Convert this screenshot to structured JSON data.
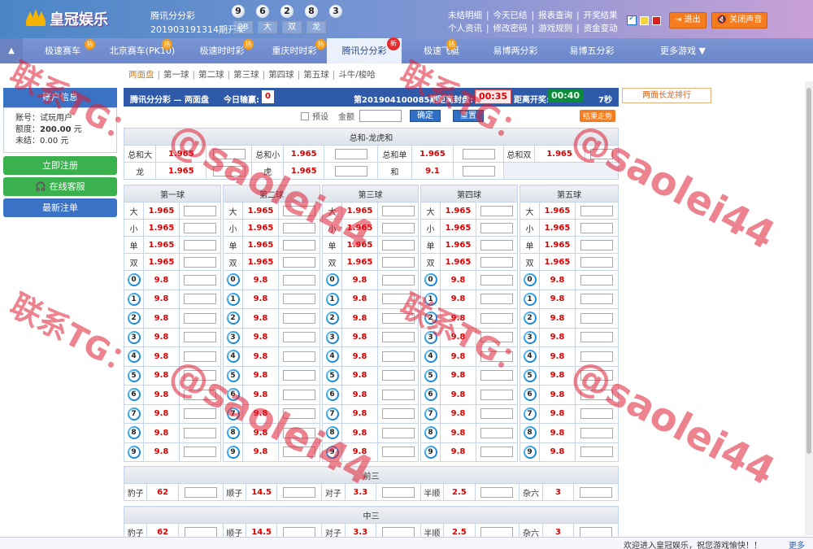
{
  "header": {
    "logo_text": "皇冠娱乐",
    "game_name": "腾讯分分彩",
    "balls": [
      "9",
      "6",
      "2",
      "8",
      "3"
    ],
    "period_text": "201903191314期开奖",
    "results": [
      "28",
      "大",
      "双",
      "龙"
    ],
    "links_row1": [
      "未结明细",
      "今天已结",
      "报表查询",
      "开奖结果"
    ],
    "links_row2": [
      "个人资讯",
      "修改密码",
      "游戏规则",
      "资金变动"
    ],
    "swatch_colors": [
      "#f5d33b",
      "#e21f1f"
    ],
    "logout": "退出",
    "mute": "关闭声音",
    "accent": "#f57c1f"
  },
  "nav": {
    "tabs": [
      {
        "label": "极速赛车",
        "badge": "热"
      },
      {
        "label": "北京赛车(PK10)",
        "badge": "热"
      },
      {
        "label": "极速时时彩",
        "badge": "热"
      },
      {
        "label": "重庆时时彩",
        "badge": "热"
      },
      {
        "label": "腾讯分分彩",
        "badge": "新"
      },
      {
        "label": "极速飞艇",
        "badge": "热"
      },
      {
        "label": "易博两分彩",
        "badge": ""
      },
      {
        "label": "易博五分彩",
        "badge": ""
      },
      {
        "label": "更多游戏 ▼",
        "badge": ""
      }
    ]
  },
  "subnav": [
    "两面盘",
    "第一球",
    "第二球",
    "第三球",
    "第四球",
    "第五球",
    "斗牛/梭哈"
  ],
  "sidebar": {
    "title": "账户信息",
    "account_label": "账号：",
    "account": "试玩用户",
    "limit_label": "额度：",
    "limit": "200.00",
    "unit": "元",
    "unsettled_label": "未结：",
    "unsettled": "0.00",
    "unsettled_unit": "元",
    "btn_bet": "立即注册",
    "btn_service": "在线客服",
    "btn_latest": "最新注单"
  },
  "infobar": {
    "game": "腾讯分分彩 — 两面盘",
    "today_label": "今日输赢:",
    "today_value": "0",
    "period": "第201904100085期",
    "close_label": "距离封盘:",
    "close_time": "00:35",
    "open_label": "距离开奖:",
    "open_time": "00:40",
    "secs": "7秒",
    "long_rank": "两面长龙排行"
  },
  "controls": {
    "preset": "预设",
    "amount": "金额",
    "confirm": "确定",
    "reset": "重置",
    "trend": "结果走势"
  },
  "sum_section": {
    "title": "总和-龙虎和",
    "row1": [
      {
        "label": "总和大",
        "odd": "1.965"
      },
      {
        "label": "总和小",
        "odd": "1.965"
      },
      {
        "label": "总和单",
        "odd": "1.965"
      },
      {
        "label": "总和双",
        "odd": "1.965"
      }
    ],
    "row2": [
      {
        "label": "龙",
        "odd": "1.965"
      },
      {
        "label": "虎",
        "odd": "1.965"
      },
      {
        "label": "和",
        "odd": "9.1"
      }
    ]
  },
  "balls_section": {
    "titles": [
      "第一球",
      "第二球",
      "第三球",
      "第四球",
      "第五球"
    ],
    "bs": [
      {
        "label": "大",
        "odd": "1.965"
      },
      {
        "label": "小",
        "odd": "1.965"
      },
      {
        "label": "单",
        "odd": "1.965"
      },
      {
        "label": "双",
        "odd": "1.965"
      }
    ],
    "numbers": [
      "0",
      "1",
      "2",
      "3",
      "4",
      "5",
      "6",
      "7",
      "8",
      "9"
    ],
    "num_odd": "9.8"
  },
  "front3": {
    "title": "前三",
    "items": [
      {
        "label": "豹子",
        "odd": "62"
      },
      {
        "label": "顺子",
        "odd": "14.5"
      },
      {
        "label": "对子",
        "odd": "3.3"
      },
      {
        "label": "半顺",
        "odd": "2.5"
      },
      {
        "label": "杂六",
        "odd": "3"
      }
    ]
  },
  "mid3": {
    "title": "中三",
    "items": [
      {
        "label": "豹子",
        "odd": "62"
      },
      {
        "label": "顺子",
        "odd": "14.5"
      },
      {
        "label": "对子",
        "odd": "3.3"
      },
      {
        "label": "半顺",
        "odd": "2.5"
      },
      {
        "label": "杂六",
        "odd": "3"
      }
    ]
  },
  "footer": {
    "message": "欢迎进入皇冠娱乐，祝您游戏愉快！！",
    "more": "更多"
  },
  "watermark": {
    "a": "联系TG：",
    "b": "@saolei44"
  }
}
